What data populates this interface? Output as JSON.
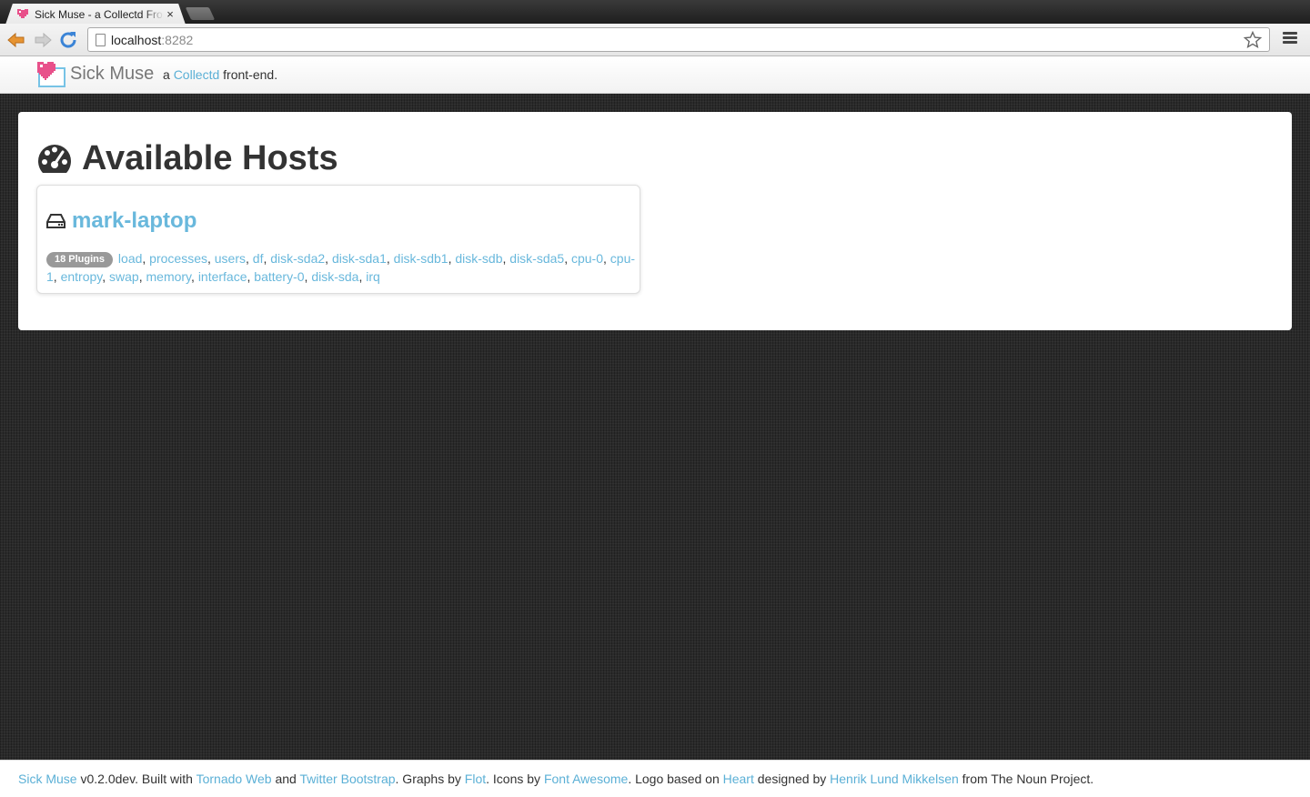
{
  "browser": {
    "tab_title": "Sick Muse - a Collectd Front-end",
    "tab_close": "×",
    "url_host": "localhost",
    "url_port": ":8282"
  },
  "navbar": {
    "brand": "Sick Muse",
    "tagline_prefix": "a ",
    "tagline_link": "Collectd",
    "tagline_suffix": " front-end."
  },
  "main": {
    "heading": "Available Hosts",
    "hosts": [
      {
        "name": "mark-laptop",
        "plugin_count_label": "18 Plugins",
        "plugins": [
          "load",
          "processes",
          "users",
          "df",
          "disk-sda2",
          "disk-sda1",
          "disk-sdb1",
          "disk-sdb",
          "disk-sda5",
          "cpu-0",
          "cpu-1",
          "entropy",
          "swap",
          "memory",
          "interface",
          "battery-0",
          "disk-sda",
          "irq"
        ]
      }
    ]
  },
  "footer": {
    "project_link": "Sick Muse",
    "version_text": " v0.2.0dev. Built with ",
    "tornado_link": "Tornado Web",
    "and_text": " and ",
    "bootstrap_link": "Twitter Bootstrap",
    "graphs_text": ". Graphs by ",
    "flot_link": "Flot",
    "icons_text": ". Icons by ",
    "fontawesome_link": "Font Awesome",
    "logo_text": ". Logo based on ",
    "heart_link": "Heart",
    "designed_text": " designed by ",
    "author_link": "Henrik Lund Mikkelsen",
    "from_text": " from The Noun Project."
  },
  "colors": {
    "link": "#69b8dc",
    "brand_pink": "#e8508a",
    "page_background": "#2b2b2b"
  },
  "icons": {
    "tab_favicon": "heart-icon",
    "back": "back-arrow-icon",
    "forward": "forward-arrow-icon",
    "reload": "reload-icon",
    "bookmark": "star-icon",
    "menu": "hamburger-menu-icon",
    "heading": "dashboard-gauge-icon",
    "host": "hdd-icon"
  }
}
